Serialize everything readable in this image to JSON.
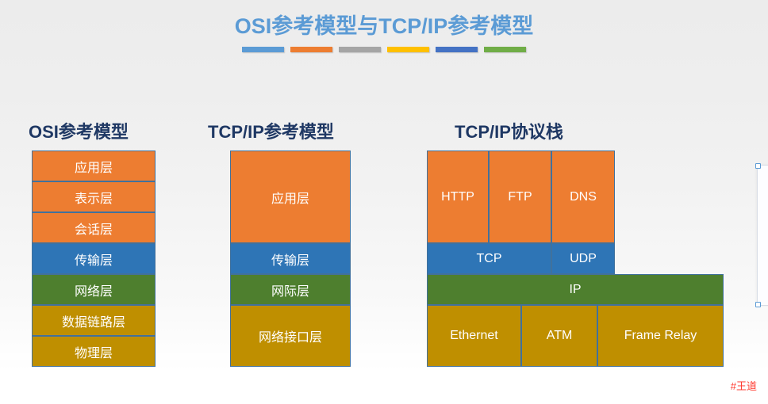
{
  "slide": {
    "title": "OSI参考模型与TCP/IP参考模型",
    "watermark": "#王道",
    "accent_bars": [
      {
        "name": "bar-blue",
        "color": "#5B9BD5"
      },
      {
        "name": "bar-orange",
        "color": "#ED7D31"
      },
      {
        "name": "bar-gray",
        "color": "#A5A5A5"
      },
      {
        "name": "bar-yellow",
        "color": "#FFC000"
      },
      {
        "name": "bar-indigo",
        "color": "#4472C4"
      },
      {
        "name": "bar-green",
        "color": "#70AD47"
      }
    ]
  },
  "palette": {
    "application": "#ED7D31",
    "transport": "#2E75B6",
    "network": "#4E7F2E",
    "link": "#BF8F00",
    "heading": "#1F3864",
    "title": "#5B9BD5",
    "border": "#41719C",
    "watermark": "#FF3B30"
  },
  "columns": {
    "osi": {
      "heading": "OSI参考模型",
      "layers": [
        {
          "label": "应用层",
          "color": "application"
        },
        {
          "label": "表示层",
          "color": "application"
        },
        {
          "label": "会话层",
          "color": "application"
        },
        {
          "label": "传输层",
          "color": "transport"
        },
        {
          "label": "网络层",
          "color": "network"
        },
        {
          "label": "数据链路层",
          "color": "link"
        },
        {
          "label": "物理层",
          "color": "link"
        }
      ]
    },
    "tcpip": {
      "heading": "TCP/IP参考模型",
      "layers": [
        {
          "label": "应用层",
          "color": "application",
          "spans": 3
        },
        {
          "label": "传输层",
          "color": "transport",
          "spans": 1
        },
        {
          "label": "网际层",
          "color": "network",
          "spans": 1
        },
        {
          "label": "网络接口层",
          "color": "link",
          "spans": 2
        }
      ]
    },
    "stack": {
      "heading": "TCP/IP协议栈",
      "rows": [
        {
          "name": "application-protocols",
          "color": "application",
          "items": [
            {
              "label": "HTTP"
            },
            {
              "label": "FTP"
            },
            {
              "label": "DNS"
            }
          ]
        },
        {
          "name": "transport-protocols",
          "color": "transport",
          "items": [
            {
              "label": "TCP"
            },
            {
              "label": "UDP"
            }
          ]
        },
        {
          "name": "internet-protocols",
          "color": "network",
          "items": [
            {
              "label": "IP"
            }
          ]
        },
        {
          "name": "link-protocols",
          "color": "link",
          "items": [
            {
              "label": "Ethernet"
            },
            {
              "label": "ATM"
            },
            {
              "label": "Frame Relay"
            }
          ]
        }
      ]
    }
  }
}
